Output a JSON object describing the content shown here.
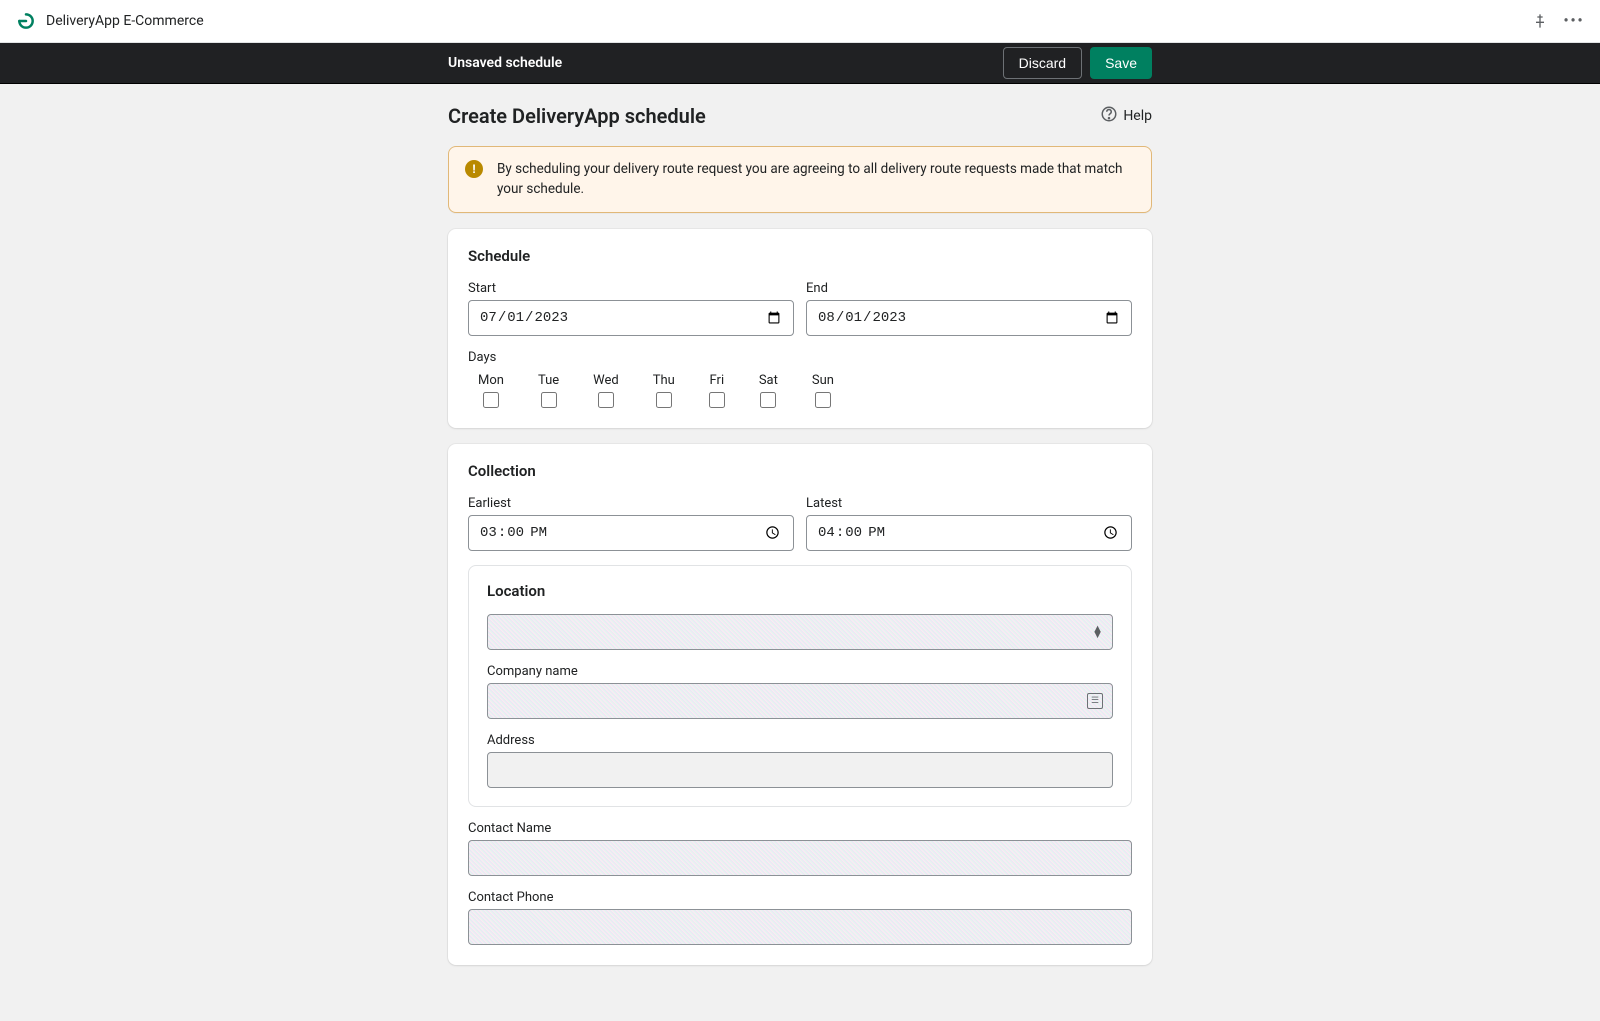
{
  "top": {
    "app_name": "DeliveryApp E-Commerce"
  },
  "save_bar": {
    "title": "Unsaved schedule",
    "discard": "Discard",
    "save": "Save"
  },
  "page": {
    "title": "Create DeliveryApp schedule",
    "help": "Help",
    "banner_text": "By scheduling your delivery route request you are agreeing to all delivery route requests made that match your schedule."
  },
  "schedule": {
    "heading": "Schedule",
    "start_label": "Start",
    "start_value": "2023-07-01",
    "end_label": "End",
    "end_value": "2023-08-01",
    "days_label": "Days",
    "days": [
      "Mon",
      "Tue",
      "Wed",
      "Thu",
      "Fri",
      "Sat",
      "Sun"
    ]
  },
  "collection": {
    "heading": "Collection",
    "earliest_label": "Earliest",
    "earliest_value": "15:00",
    "latest_label": "Latest",
    "latest_value": "16:00",
    "location_heading": "Location",
    "company_label": "Company name",
    "address_label": "Address",
    "contact_name_label": "Contact Name",
    "contact_phone_label": "Contact Phone"
  }
}
